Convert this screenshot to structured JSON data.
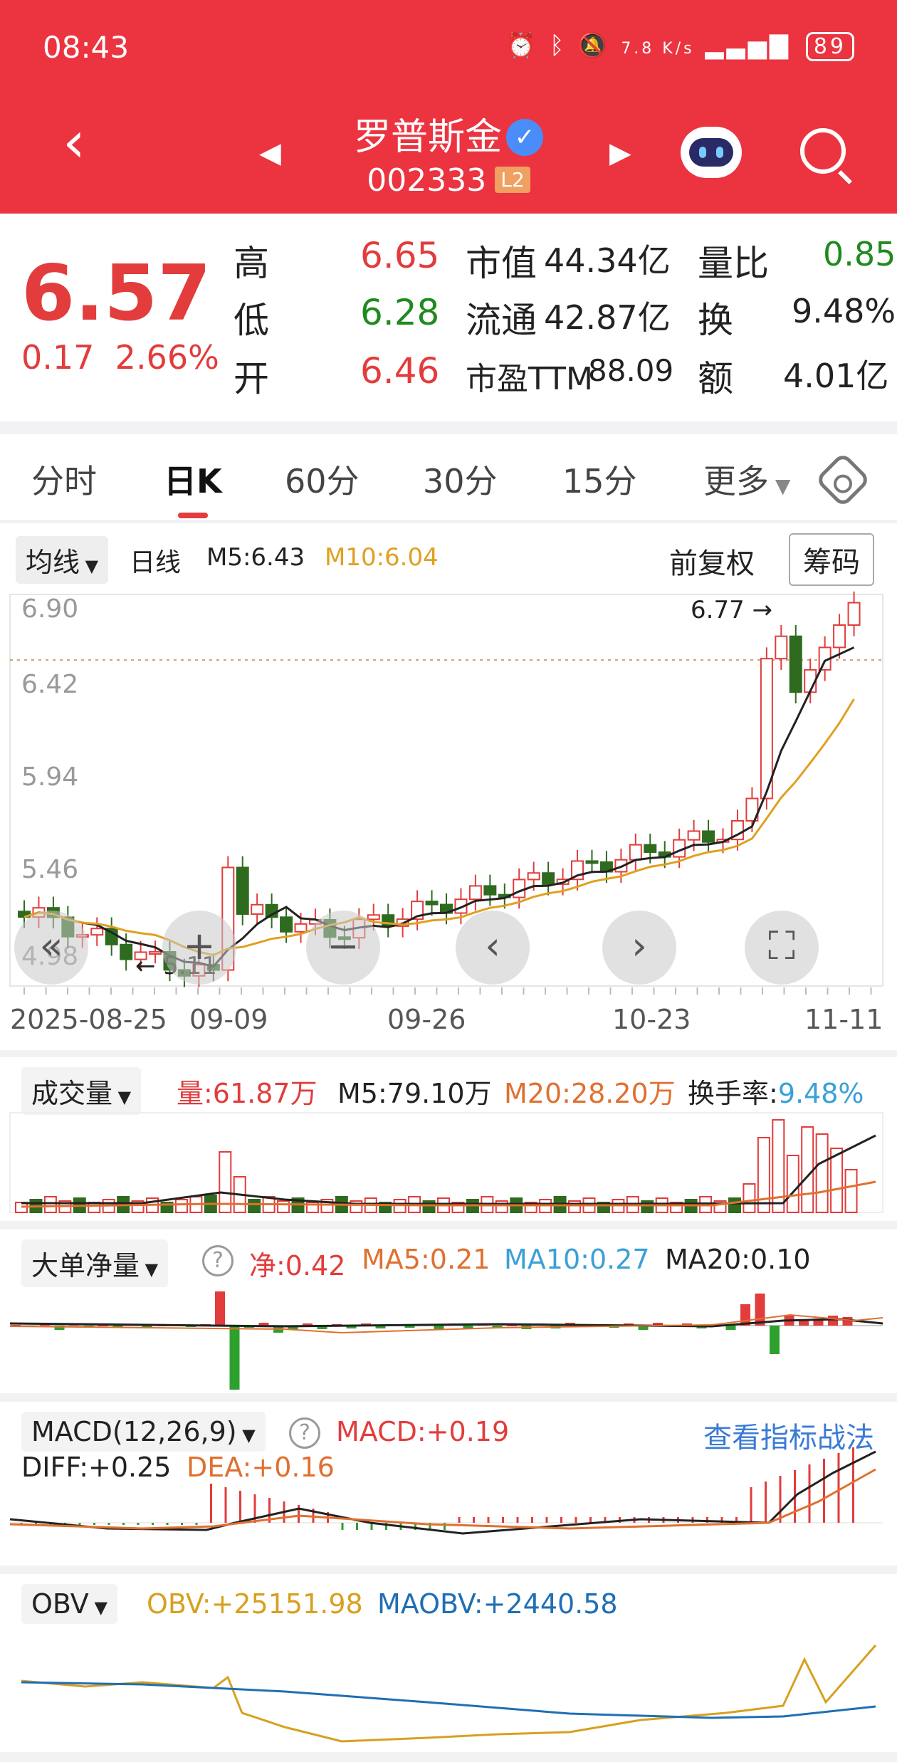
{
  "status": {
    "time": "08:43",
    "net": "7.8 K/s",
    "battery": "89"
  },
  "header": {
    "name": "罗普斯金",
    "code": "002333",
    "level": "L2"
  },
  "quote": {
    "price": "6.57",
    "change": "0.17",
    "change_pct": "2.66%",
    "high_label": "高",
    "high": "6.65",
    "low_label": "低",
    "low": "6.28",
    "open_label": "开",
    "open": "6.46",
    "mcap_label": "市值",
    "mcap": "44.34亿",
    "float_label": "流通",
    "float": "42.87亿",
    "pe_label": "市盈TTM",
    "pe": "88.09",
    "vr_label": "量比",
    "vr": "0.85",
    "turn_label": "换",
    "turn": "9.48%",
    "amt_label": "额",
    "amt": "4.01亿"
  },
  "tabs": [
    "分时",
    "日K",
    "60分",
    "30分",
    "15分",
    "更多"
  ],
  "kline": {
    "ma_selector": "均线",
    "period": "日线",
    "m5": "M5:6.43",
    "m10": "M10:6.04",
    "adjust": "前复权",
    "chips": "筹码",
    "y_ticks": [
      "6.90",
      "6.42",
      "5.94",
      "5.46",
      "4.98"
    ],
    "x_ticks": [
      "2025-08-25",
      "09-09",
      "09-26",
      "10-23",
      "11-11"
    ],
    "high_mark": "6.77",
    "low_mark": "5.11"
  },
  "volume": {
    "selector": "成交量",
    "vol": "量:61.87万",
    "m5": "M5:79.10万",
    "m20": "M20:28.20万",
    "turn_label": "换手率:",
    "turn": "9.48%"
  },
  "bigorder": {
    "selector": "大单净量",
    "net": "净:0.42",
    "ma5": "MA5:0.21",
    "ma10": "MA10:0.27",
    "ma20": "MA20:0.10"
  },
  "macd": {
    "selector": "MACD(12,26,9)",
    "macd": "MACD:+0.19",
    "link": "查看指标战法",
    "diff": "DIFF:+0.25",
    "dea": "DEA:+0.16"
  },
  "obv": {
    "selector": "OBV",
    "obv": "OBV:+25151.98",
    "maobv": "MAOBV:+2440.58"
  },
  "colors": {
    "up": "#e23c3c",
    "down": "#2e6b1f",
    "ma5": "#222222",
    "ma10": "#e0a020",
    "accent": "#ec3340"
  }
}
